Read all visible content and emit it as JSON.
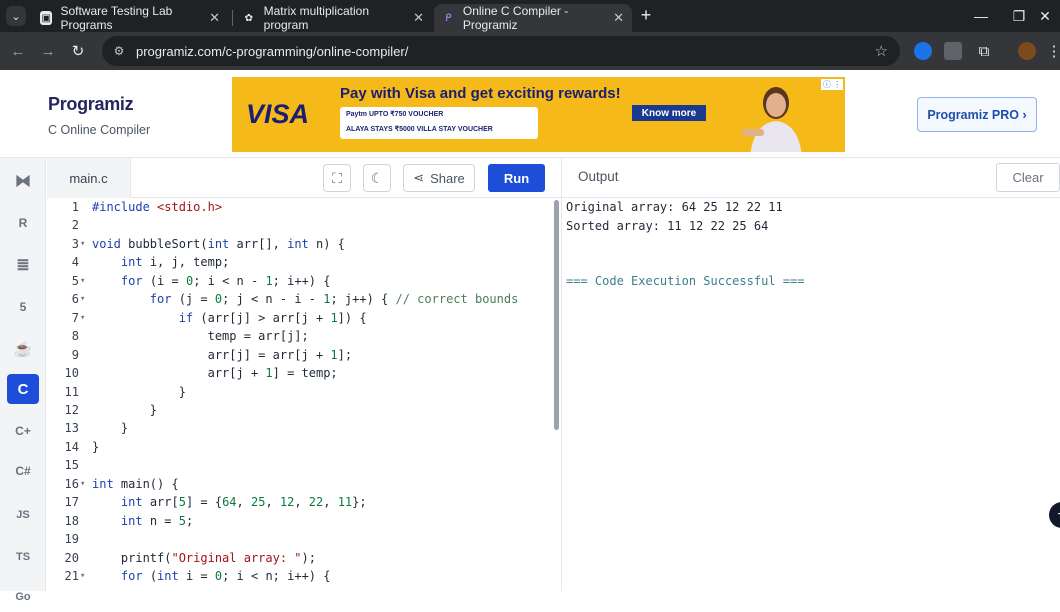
{
  "browser": {
    "tabs": [
      {
        "title": "Software Testing Lab Programs"
      },
      {
        "title": "Matrix multiplication program"
      },
      {
        "title": "Online C Compiler - Programiz"
      }
    ],
    "url": "programiz.com/c-programming/online-compiler/"
  },
  "site": {
    "logo": "Programiz",
    "subtitle": "C Online Compiler",
    "pro_button": "Programiz PRO ›"
  },
  "ad": {
    "brand": "VISA",
    "headline": "Pay with Visa and get exciting rewards!",
    "voucher_line1": "Paytm UPTO ₹750 VOUCHER",
    "voucher_line2": "ALAYA STAYS ₹5000 VILLA STAY VOUCHER",
    "cta": "Know more"
  },
  "languages": [
    "Python",
    "R",
    "SQL",
    "HTML",
    "Java",
    "C",
    "C++",
    "C#",
    "JS",
    "TS",
    "Go"
  ],
  "editor": {
    "filename": "main.c",
    "share_label": "Share",
    "run_label": "Run"
  },
  "code_lines": [
    {
      "n": "1",
      "fold": "",
      "html": "<span class='kw'>#include</span> <span class='str'>&lt;stdio.h&gt;</span>"
    },
    {
      "n": "2",
      "fold": "",
      "html": ""
    },
    {
      "n": "3",
      "fold": "▾",
      "html": "<span class='kw'>void</span> bubbleSort(<span class='kw'>int</span> arr[], <span class='kw'>int</span> n) {"
    },
    {
      "n": "4",
      "fold": "",
      "html": "    <span class='kw'>int</span> i, j, temp;"
    },
    {
      "n": "5",
      "fold": "▾",
      "html": "    <span class='kw'>for</span> (i = <span class='num'>0</span>; i &lt; n - <span class='num'>1</span>; i++) {"
    },
    {
      "n": "6",
      "fold": "▾",
      "html": "        <span class='kw'>for</span> (j = <span class='num'>0</span>; j &lt; n - i - <span class='num'>1</span>; j++) { <span class='com'>// correct bounds</span>"
    },
    {
      "n": "7",
      "fold": "▾",
      "html": "            <span class='kw'>if</span> (arr[j] &gt; arr[j + <span class='num'>1</span>]) {"
    },
    {
      "n": "8",
      "fold": "",
      "html": "                temp = arr[j];"
    },
    {
      "n": "9",
      "fold": "",
      "html": "                arr[j] = arr[j + <span class='num'>1</span>];"
    },
    {
      "n": "10",
      "fold": "",
      "html": "                arr[j + <span class='num'>1</span>] = temp;"
    },
    {
      "n": "11",
      "fold": "",
      "html": "            }"
    },
    {
      "n": "12",
      "fold": "",
      "html": "        }"
    },
    {
      "n": "13",
      "fold": "",
      "html": "    }"
    },
    {
      "n": "14",
      "fold": "",
      "html": "}"
    },
    {
      "n": "15",
      "fold": "",
      "html": ""
    },
    {
      "n": "16",
      "fold": "▾",
      "html": "<span class='kw'>int</span> main() {"
    },
    {
      "n": "17",
      "fold": "",
      "html": "    <span class='kw'>int</span> arr[<span class='num'>5</span>] = {<span class='num'>64</span>, <span class='num'>25</span>, <span class='num'>12</span>, <span class='num'>22</span>, <span class='num'>11</span>};"
    },
    {
      "n": "18",
      "fold": "",
      "html": "    <span class='kw'>int</span> n = <span class='num'>5</span>;"
    },
    {
      "n": "19",
      "fold": "",
      "html": ""
    },
    {
      "n": "20",
      "fold": "",
      "html": "    printf(<span class='str'>\"Original array: \"</span>);"
    },
    {
      "n": "21",
      "fold": "▾",
      "html": "    <span class='kw'>for</span> (<span class='kw'>int</span> i = <span class='num'>0</span>; i &lt; n; i++) {"
    }
  ],
  "output": {
    "title": "Output",
    "clear_label": "Clear",
    "lines": [
      "Original array: 64 25 12 22 11",
      "Sorted array: 11 12 22 25 64",
      "",
      "",
      "=== Code Execution Successful ==="
    ]
  }
}
